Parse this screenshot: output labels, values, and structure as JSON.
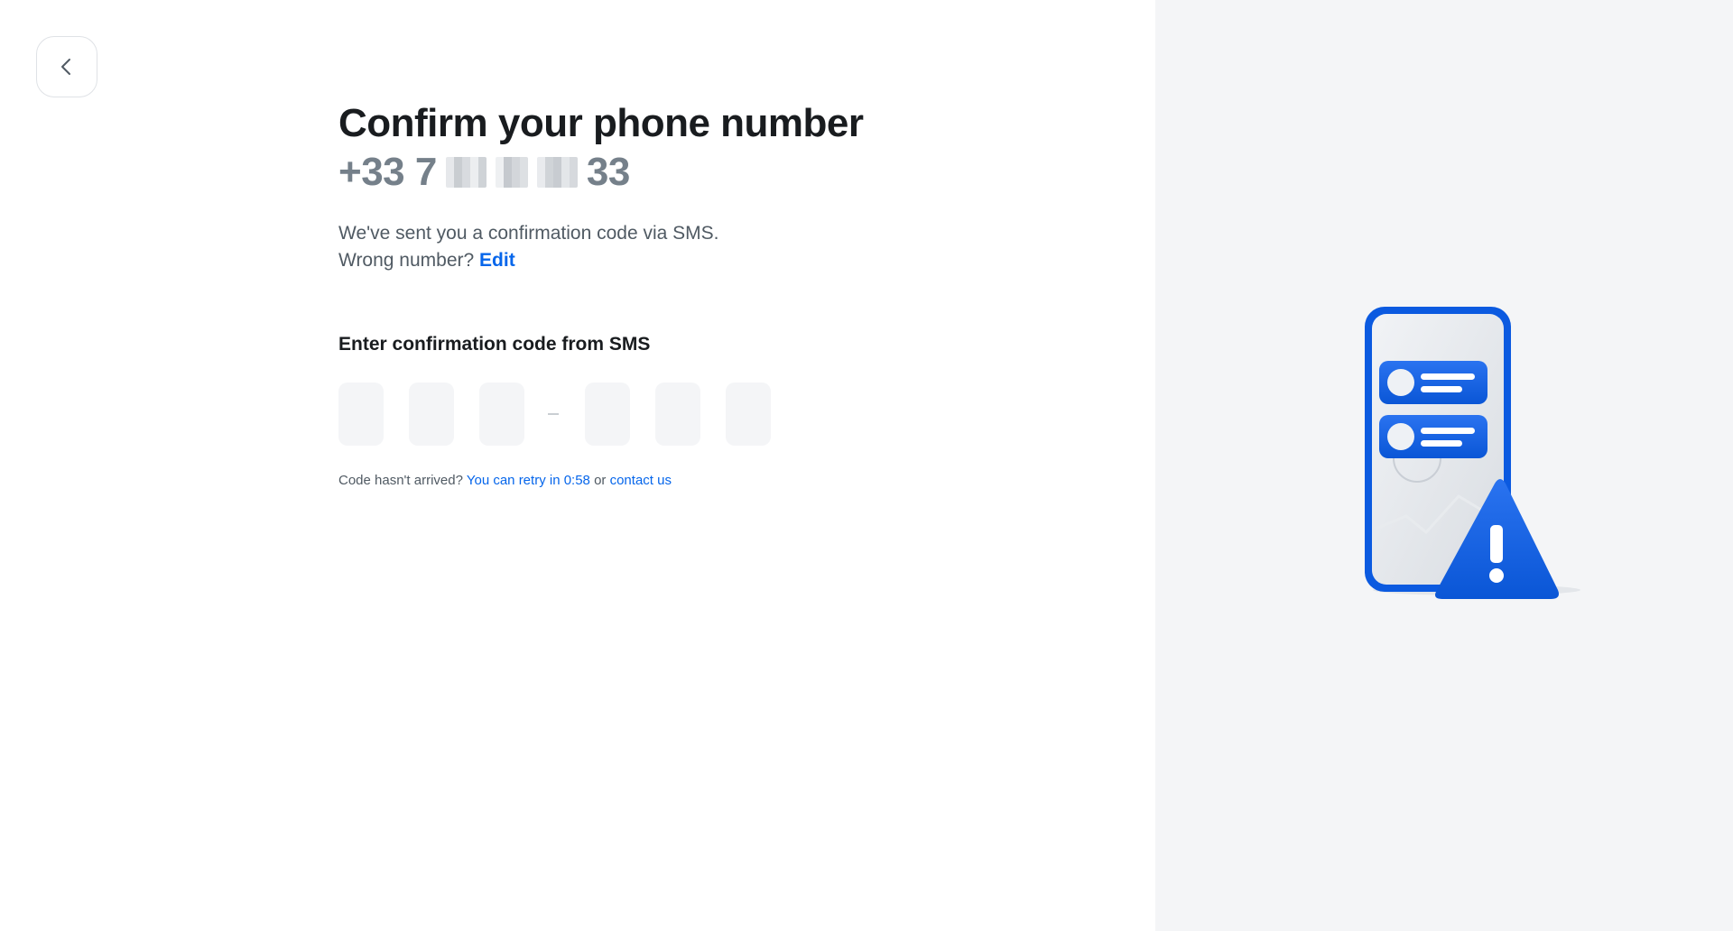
{
  "header": {
    "back_icon": "chevron-left-icon"
  },
  "main": {
    "title": "Confirm your phone number",
    "phone_prefix": "+33 7",
    "phone_suffix": "33",
    "sent_text": "We've sent you a confirmation code via SMS.",
    "wrong_number_text": "Wrong number?",
    "edit_link": "Edit",
    "code_label": "Enter confirmation code from SMS",
    "code_digits": [
      "",
      "",
      "",
      "",
      "",
      ""
    ],
    "hint_text": "Code hasn't arrived?",
    "retry_link": "You can retry in 0:58",
    "or_text": "or",
    "contact_link": "contact us"
  },
  "illustration": {
    "icon": "phone-warning-illustration"
  },
  "colors": {
    "accent": "#0666eb",
    "panel_bg": "#f4f5f7",
    "muted": "#75808a"
  }
}
